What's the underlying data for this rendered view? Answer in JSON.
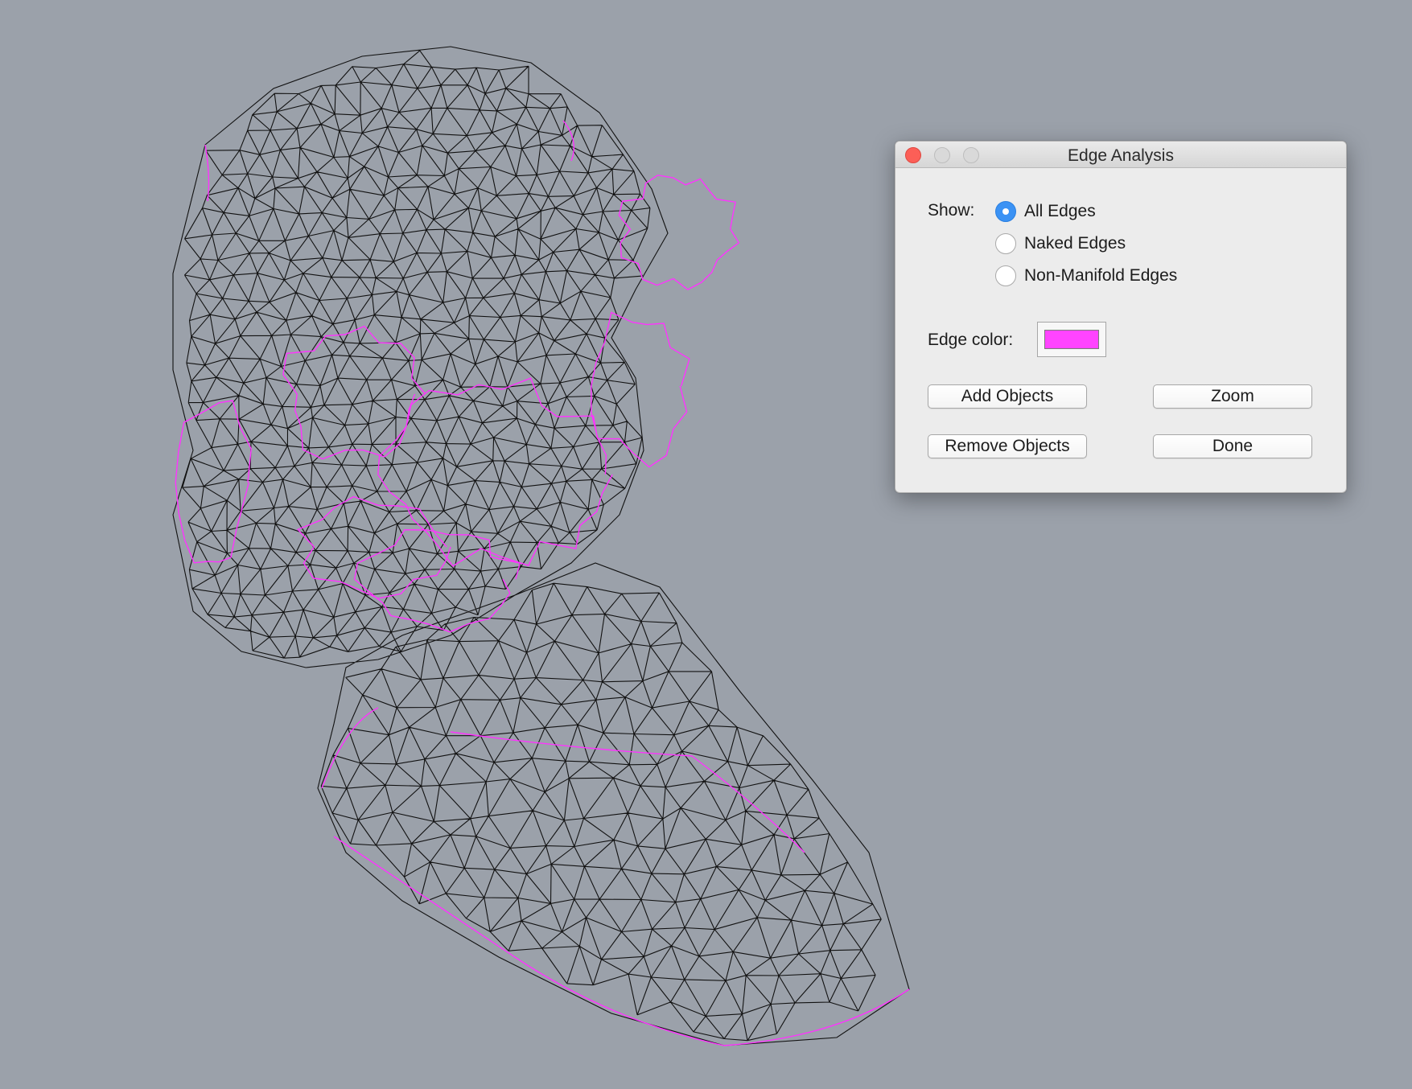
{
  "dialog": {
    "title": "Edge Analysis",
    "show_label": "Show:",
    "options": [
      {
        "label": "All Edges",
        "checked": true
      },
      {
        "label": "Naked Edges",
        "checked": false
      },
      {
        "label": "Non-Manifold Edges",
        "checked": false
      }
    ],
    "edge_color_label": "Edge color:",
    "edge_color": "#ff44ff",
    "buttons": {
      "add_objects": "Add Objects",
      "zoom": "Zoom",
      "remove_objects": "Remove Objects",
      "done": "Done"
    }
  },
  "viewport": {
    "background": "#9ba1aa",
    "mesh_color": "#111111",
    "naked_edge_color": "#ff33ff"
  }
}
